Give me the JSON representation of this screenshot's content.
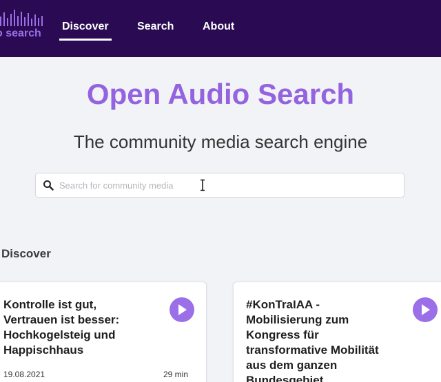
{
  "colors": {
    "navbar_bg": "#2a0a53",
    "accent": "#9a6fe8",
    "title": "#9463e0",
    "page_bg": "#f1f3f6"
  },
  "logo": {
    "text": "o search",
    "icon": "audio-waveform-icon"
  },
  "nav": {
    "items": [
      {
        "label": "Discover",
        "active": true
      },
      {
        "label": "Search",
        "active": false
      },
      {
        "label": "About",
        "active": false
      }
    ]
  },
  "hero": {
    "title": "Open Audio Search",
    "subtitle": "The community media search engine"
  },
  "search": {
    "placeholder": "Search for community media",
    "value": "",
    "icon": "search-icon"
  },
  "discover": {
    "heading": "Discover",
    "cards": [
      {
        "title": "Kontrolle ist gut, Vertrauen ist besser: Hochkogelsteig und Happischhaus",
        "date": "19.08.2021",
        "duration": "29 min",
        "icon": "play-icon"
      },
      {
        "title": "#KonTraIAA - Mobilisierung zum Kongress für transformative Mobilität aus dem ganzen Bundesgebiet",
        "icon": "play-icon"
      }
    ]
  }
}
